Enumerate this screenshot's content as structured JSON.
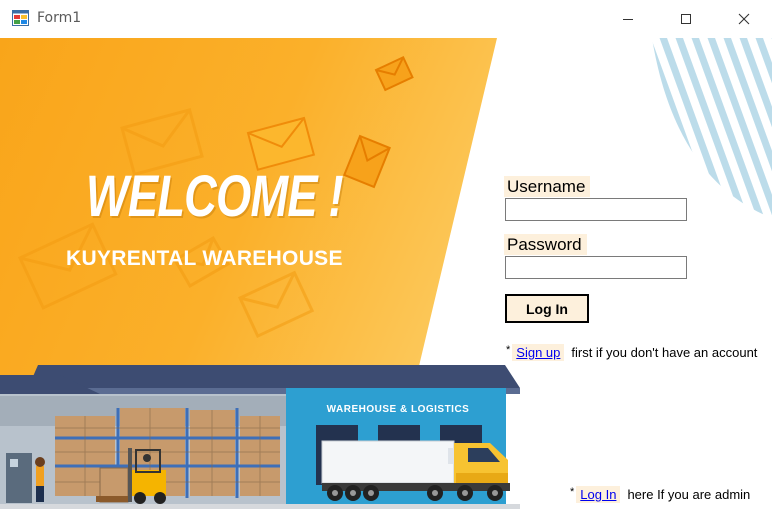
{
  "window": {
    "title": "Form1",
    "controls": {
      "minimize": "minimize-icon",
      "maximize": "maximize-icon",
      "close": "close-icon"
    }
  },
  "banner": {
    "welcome": "WELCOME !",
    "subtitle": "KUYRENTAL WAREHOUSE",
    "building_sign": "WAREHOUSE & LOGISTICS"
  },
  "login_form": {
    "username_label": "Username",
    "username_value": "",
    "password_label": "Password",
    "password_value": "",
    "login_button": "Log In"
  },
  "signup_hint": {
    "prefix": "*",
    "link": "Sign up",
    "suffix": "first if you don't have an account"
  },
  "admin_hint": {
    "prefix": "*",
    "link": "Log In",
    "suffix": "here If you are admin"
  },
  "colors": {
    "banner_orange": "#FBAE1C",
    "label_bg": "#FDF0DC",
    "link": "#0000EE",
    "warehouse_blue": "#2D9FD1",
    "stripe": "#BBDDEB"
  }
}
